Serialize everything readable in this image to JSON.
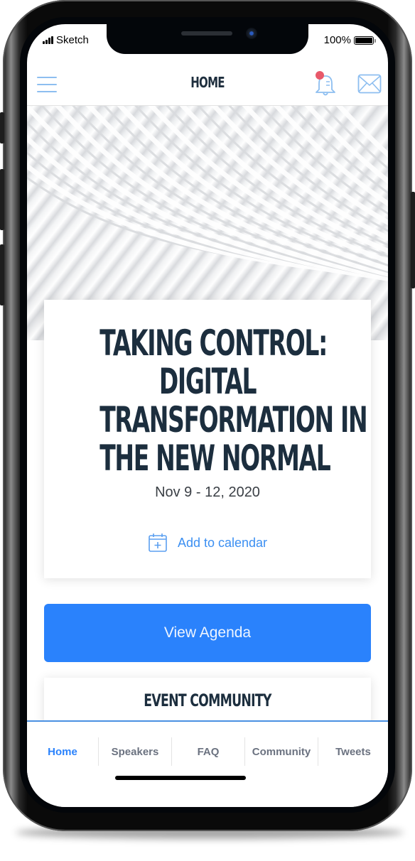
{
  "status_bar": {
    "carrier": "Sketch",
    "battery_percent": "100%",
    "battery_level": 1.0
  },
  "header": {
    "title": "HOME",
    "menu_icon": "hamburger-menu-icon",
    "notification_icon": "bell-icon",
    "notification_badge": true,
    "message_icon": "envelope-icon"
  },
  "event": {
    "title_lines": [
      "TAKING CONTROL:",
      "DIGITAL",
      "TRANSFORMATION IN",
      "THE NEW NORMAL"
    ],
    "dates": "Nov 9 - 12, 2020",
    "add_to_calendar_label": "Add to calendar",
    "add_to_calendar_icon": "calendar-plus-icon"
  },
  "agenda_button": {
    "label": "View Agenda"
  },
  "community_section": {
    "title": "EVENT COMMUNITY"
  },
  "tabs": [
    {
      "label": "Home",
      "active": true
    },
    {
      "label": "Speakers",
      "active": false
    },
    {
      "label": "FAQ",
      "active": false
    },
    {
      "label": "Community",
      "active": false
    },
    {
      "label": "Tweets",
      "active": false
    }
  ],
  "colors": {
    "accent": "#2a82fc",
    "icon_blue": "#8dbef0",
    "badge_red": "#e8596a",
    "heading_dark": "#1c2e3e"
  }
}
